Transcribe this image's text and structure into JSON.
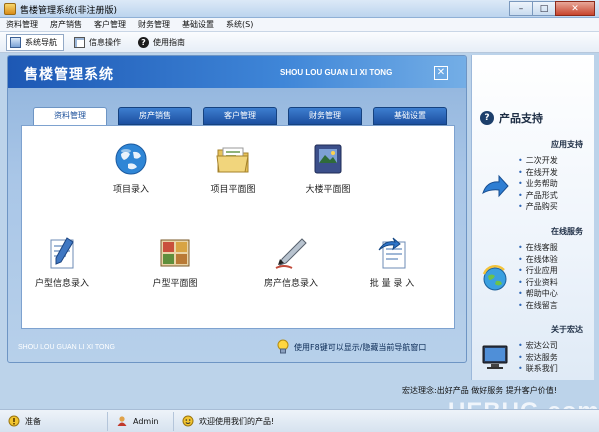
{
  "window": {
    "title": "售楼管理系统(非注册版)",
    "buttons": [
      "–",
      "□",
      "✕"
    ]
  },
  "menu": [
    "资料管理",
    "房产销售",
    "客户管理",
    "财务管理",
    "基础设置",
    "系统(S)"
  ],
  "toolbar": [
    {
      "label": "系统导航",
      "icon": "navigation-icon"
    },
    {
      "label": "信息操作",
      "icon": "info-icon"
    },
    {
      "label": "使用指南",
      "icon": "help-icon"
    }
  ],
  "main": {
    "title": "售楼管理系统",
    "subtitle": "SHOU LOU GUAN LI XI TONG",
    "close": "✕",
    "tabs": [
      "资料管理",
      "房产销售",
      "客户管理",
      "财务管理",
      "基础设置"
    ],
    "items": [
      {
        "label": "项目录入",
        "icon": "globe-icon"
      },
      {
        "label": "项目平面图",
        "icon": "folder-icon"
      },
      {
        "label": "大楼平面图",
        "icon": "photo-album-icon"
      },
      {
        "label": "户型信息录入",
        "icon": "document-pen-icon"
      },
      {
        "label": "户型平面图",
        "icon": "floor-plan-icon"
      },
      {
        "label": "房产信息录入",
        "icon": "pen-icon"
      },
      {
        "label": "批 量 录 入",
        "icon": "notepad-icon"
      }
    ],
    "footer_left": "SHOU LOU GUAN LI XI TONG",
    "hint": "使用F8键可以显示/隐藏当前导航窗口"
  },
  "support": {
    "title": "产品支持",
    "sections": [
      {
        "title": "应用支持",
        "items": [
          "二次开发",
          "在线开发",
          "业务帮助",
          "产品形式",
          "产品购买"
        ],
        "icon": "arrow-icon"
      },
      {
        "title": "在线服务",
        "items": [
          "在线客服",
          "在线体验",
          "行业应用",
          "行业资料",
          "帮助中心",
          "在线留言"
        ],
        "icon": "refresh-globe-icon"
      },
      {
        "title": "关于宏达",
        "items": [
          "宏达公司",
          "宏达服务",
          "联系我们"
        ],
        "icon": "monitor-icon"
      }
    ],
    "slogan": "宏达理念:出好产品 做好服务 提升客户价值!"
  },
  "status": {
    "ready": "准备",
    "user": "Admin",
    "welcome": "欢迎使用我们的产品!"
  },
  "watermark": "UEBUG.com"
}
